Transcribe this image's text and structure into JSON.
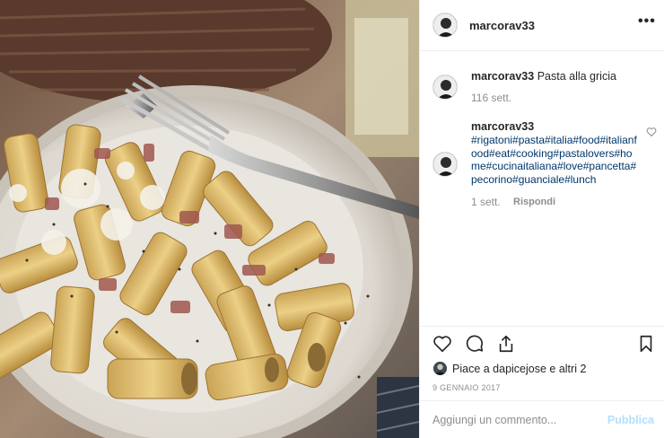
{
  "post": {
    "image": {
      "alt_icon": "pasta-photo"
    },
    "header": {
      "username": "marcorav33",
      "more_label": "•••"
    },
    "caption": {
      "username": "marcorav33",
      "text": "Pasta alla gricia",
      "time": "116 sett."
    },
    "comment": {
      "username": "marcorav33",
      "text": "#rigatoni#pasta#italia#food#italianfood#eat#cooking#pastalovers#home#cucinaitaliana#love#pancetta#pecorino#guanciale#lunch",
      "time": "1 sett.",
      "reply_label": "Rispondi",
      "like_icon": "heart-outline-icon"
    },
    "actions": {
      "like_icon": "heart-icon",
      "comment_icon": "comment-icon",
      "share_icon": "share-icon",
      "save_icon": "bookmark-icon"
    },
    "likes": {
      "text": "Piace a dapicejose e altri 2"
    },
    "date": "9 GENNAIO 2017",
    "add_comment": {
      "placeholder": "Aggiungi un commento...",
      "publish_label": "Pubblica"
    }
  },
  "colors": {
    "link": "#00376b",
    "muted": "#8e8e8e",
    "publish_disabled": "#b2dffc",
    "text": "#262626"
  }
}
